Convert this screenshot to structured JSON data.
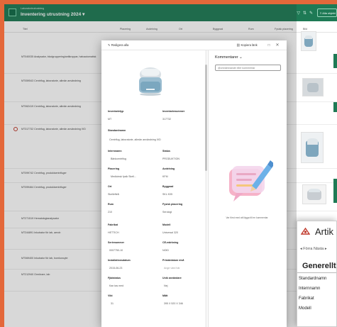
{
  "app": {
    "workspace": "Laboratorieutrustning",
    "title": "Inventering utrustning 2024",
    "views_label": "Alla objekt"
  },
  "columns": [
    "Titel",
    "Placering",
    "Avdelning",
    "Ort",
    "Byggnad",
    "Rum",
    "Fysisk placering",
    "Bild"
  ],
  "rows": [
    {
      "title": "MT040035 Analysator, blodgruppering/antikroppar, halvautomatisk"
    },
    {
      "title": "MT059543 Centrifug, laboratorie, allmän användning"
    },
    {
      "title": "MT062419 Centrifug, laboratorie, allmän användning"
    },
    {
      "title": "MT317732 Centrifug, laboratorie, allmän användning IVD"
    },
    {
      "title": "MT099742 Centrifug, produktcentrifuger"
    },
    {
      "title": "MT099464 Centrifug, produktcentrifuger"
    },
    {
      "title": "MT271519 Hematologianalysator"
    },
    {
      "title": "MT244891 Inkubator för lab, aerob"
    },
    {
      "title": "MT069400 Inkubator för lab, bomkoncyte"
    },
    {
      "title": "MT212940 Omrörare, lab"
    }
  ],
  "dialog": {
    "edit_label": "Redigera alla",
    "copy_link_label": "Kopiera länk",
    "close_symbol": "✕",
    "fields": [
      {
        "label": "Inventarietyp",
        "value": "MT"
      },
      {
        "label": "Inventarienummer",
        "value": "317732"
      },
      {
        "label": "Standardnamn",
        "value": "Centrifug, laboratorie, allmän användning IVD"
      },
      {
        "label": "Internnamn",
        "value": "Bänkcentrifug"
      },
      {
        "label": "Status",
        "value": "PRODUKTION"
      },
      {
        "label": "Placering",
        "value": "Medicinsk fysik Skell..."
      },
      {
        "label": "Avdelning",
        "value": "KFM"
      },
      {
        "label": "Ort",
        "value": "Skellefteå"
      },
      {
        "label": "Byggnad",
        "value": "SKL K05"
      },
      {
        "label": "Rum",
        "value": "210"
      },
      {
        "label": "Fysisk placering",
        "value": "Serologi"
      },
      {
        "label": "Fabrikat",
        "value": "HETTICH"
      },
      {
        "label": "Modell",
        "value": "Universal 320"
      },
      {
        "label": "Serienummer",
        "value": "0007750-10"
      },
      {
        "label": "CE-märkning",
        "value": "NOID"
      },
      {
        "label": "Installationsdatum",
        "value": "2015-06-23"
      },
      {
        "label": "Primärdatum nivå",
        "value": "Ange värd här"
      },
      {
        "label": "Fjädstatus",
        "value": "Kan tas med"
      },
      {
        "label": "Unik användare",
        "value": "Nej"
      },
      {
        "label": "Vikt",
        "value": "31"
      },
      {
        "label": "Mått",
        "value": "395 X 520 X 346"
      }
    ],
    "comments": {
      "title": "Kommentarer",
      "placeholder": "@omnämnande eller kommentar",
      "empty_text": "Var först med att lägga till en kommentar"
    }
  },
  "second_window": {
    "title": "Artik",
    "nav": "◂ Förra  Nästa ▸",
    "section": "Generellt",
    "fields": [
      "Standardnamn",
      "Internnamn",
      "Fabrikat",
      "Modell"
    ]
  },
  "colors": {
    "brand": "#1e7a55",
    "background": "#e4683a"
  }
}
